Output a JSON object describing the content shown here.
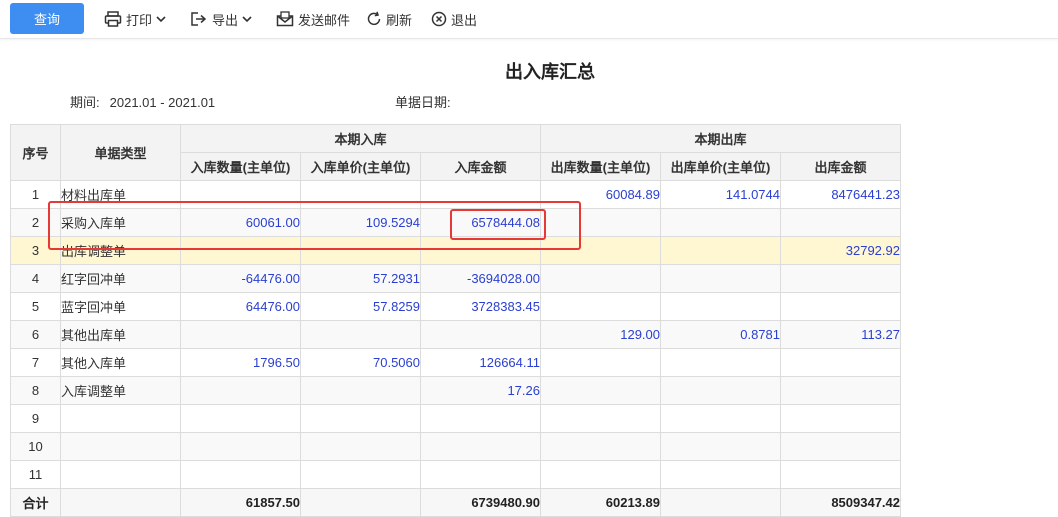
{
  "toolbar": {
    "query_label": "查询",
    "print_label": "打印",
    "export_label": "导出",
    "email_label": "发送邮件",
    "refresh_label": "刷新",
    "exit_label": "退出"
  },
  "report": {
    "title": "出入库汇总",
    "period_label": "期间:",
    "period_value": "2021.01 - 2021.01",
    "date_label": "单据日期:"
  },
  "table": {
    "headers": {
      "index": "序号",
      "type": "单据类型",
      "in_group": "本期入库",
      "out_group": "本期出库",
      "in_qty": "入库数量(主单位)",
      "in_price": "入库单价(主单位)",
      "in_amount": "入库金额",
      "out_qty": "出库数量(主单位)",
      "out_price": "出库单价(主单位)",
      "out_amount": "出库金额"
    },
    "rows": [
      {
        "index": "1",
        "type": "材料出库单",
        "in_qty": "",
        "in_price": "",
        "in_amount": "",
        "out_qty": "60084.89",
        "out_price": "141.0744",
        "out_amount": "8476441.23"
      },
      {
        "index": "2",
        "type": "采购入库单",
        "in_qty": "60061.00",
        "in_price": "109.5294",
        "in_amount": "6578444.08",
        "out_qty": "",
        "out_price": "",
        "out_amount": ""
      },
      {
        "index": "3",
        "type": "出库调整单",
        "in_qty": "",
        "in_price": "",
        "in_amount": "",
        "out_qty": "",
        "out_price": "",
        "out_amount": "32792.92"
      },
      {
        "index": "4",
        "type": "红字回冲单",
        "in_qty": "-64476.00",
        "in_price": "57.2931",
        "in_amount": "-3694028.00",
        "out_qty": "",
        "out_price": "",
        "out_amount": ""
      },
      {
        "index": "5",
        "type": "蓝字回冲单",
        "in_qty": "64476.00",
        "in_price": "57.8259",
        "in_amount": "3728383.45",
        "out_qty": "",
        "out_price": "",
        "out_amount": ""
      },
      {
        "index": "6",
        "type": "其他出库单",
        "in_qty": "",
        "in_price": "",
        "in_amount": "",
        "out_qty": "129.00",
        "out_price": "0.8781",
        "out_amount": "113.27"
      },
      {
        "index": "7",
        "type": "其他入库单",
        "in_qty": "1796.50",
        "in_price": "70.5060",
        "in_amount": "126664.11",
        "out_qty": "",
        "out_price": "",
        "out_amount": ""
      },
      {
        "index": "8",
        "type": "入库调整单",
        "in_qty": "",
        "in_price": "",
        "in_amount": "17.26",
        "out_qty": "",
        "out_price": "",
        "out_amount": ""
      },
      {
        "index": "9",
        "type": "",
        "in_qty": "",
        "in_price": "",
        "in_amount": "",
        "out_qty": "",
        "out_price": "",
        "out_amount": ""
      },
      {
        "index": "10",
        "type": "",
        "in_qty": "",
        "in_price": "",
        "in_amount": "",
        "out_qty": "",
        "out_price": "",
        "out_amount": ""
      },
      {
        "index": "11",
        "type": "",
        "in_qty": "",
        "in_price": "",
        "in_amount": "",
        "out_qty": "",
        "out_price": "",
        "out_amount": ""
      }
    ],
    "total": {
      "label": "合计",
      "in_qty": "61857.50",
      "in_price": "",
      "in_amount": "6739480.90",
      "out_qty": "60213.89",
      "out_price": "",
      "out_amount": "8509347.42"
    }
  },
  "colors": {
    "primary": "#3d8ef0",
    "link_number": "#2a3fd1",
    "highlight_row": "#fff6d2",
    "annotation": "#e53935"
  },
  "icons": {
    "print": "printer-icon",
    "export": "export-icon",
    "email": "mail-icon",
    "refresh": "refresh-icon",
    "exit": "close-circle-icon"
  }
}
